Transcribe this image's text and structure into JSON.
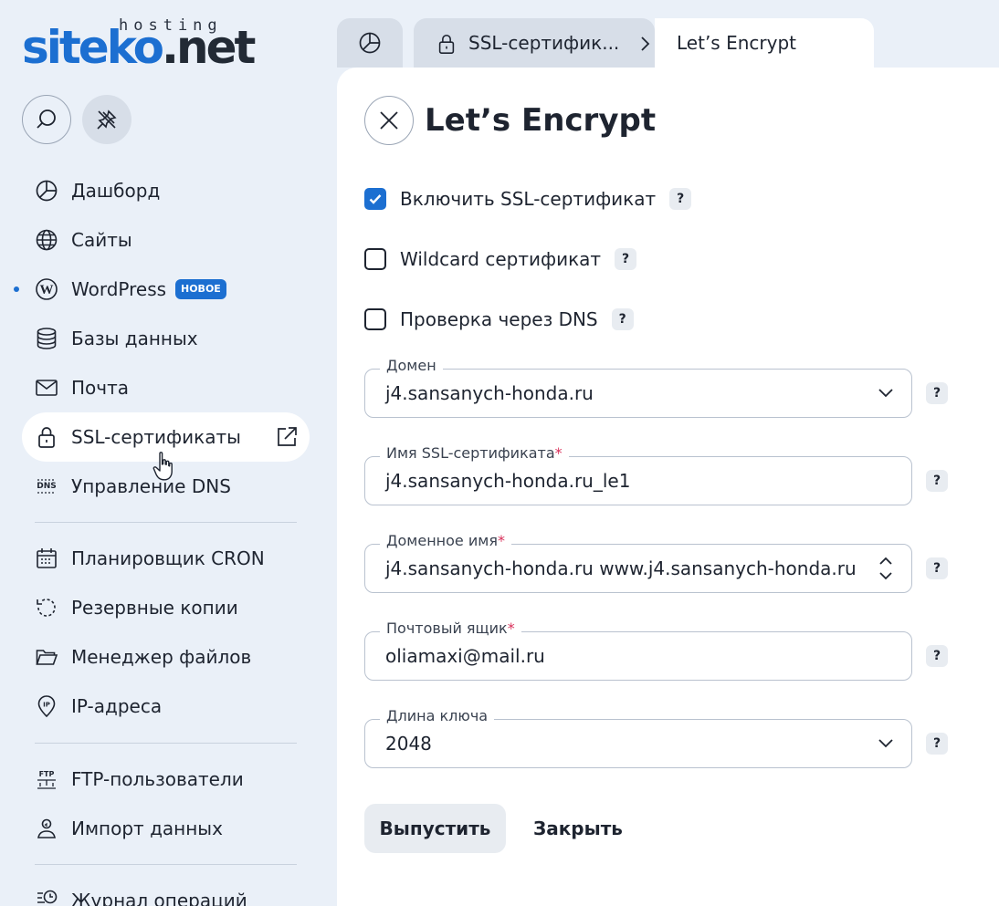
{
  "logo": {
    "brand_blue": "siteko",
    "brand_dark": ".net",
    "tagline": "hosting"
  },
  "sidebar": {
    "search_icon": "search-icon",
    "pin_icon": "unpin-icon",
    "items": [
      {
        "label": "Дашборд",
        "icon": "pie-chart-icon"
      },
      {
        "label": "Сайты",
        "icon": "globe-icon"
      },
      {
        "label": "WordPress",
        "icon": "wordpress-icon",
        "badge": "НОВОЕ"
      },
      {
        "label": "Базы данных",
        "icon": "database-icon"
      },
      {
        "label": "Почта",
        "icon": "mail-icon"
      },
      {
        "label": "SSL-сертификаты",
        "icon": "lock-icon",
        "active": true
      },
      {
        "label": "Управление DNS",
        "icon": "dns-icon"
      },
      {
        "label": "Планировщик CRON",
        "icon": "calendar-icon"
      },
      {
        "label": "Резервные копии",
        "icon": "backup-icon"
      },
      {
        "label": "Менеджер файлов",
        "icon": "folder-icon"
      },
      {
        "label": "IP-адреса",
        "icon": "ip-pin-icon"
      },
      {
        "label": "FTP-пользователи",
        "icon": "ftp-icon"
      },
      {
        "label": "Импорт данных",
        "icon": "import-icon"
      },
      {
        "label": "Журнал операций",
        "icon": "log-icon"
      }
    ]
  },
  "breadcrumb": {
    "home_icon": "pie-chart-icon",
    "parent_label": "SSL-сертифик...",
    "current_label": "Let’s Encrypt"
  },
  "form": {
    "title": "Let’s Encrypt",
    "help_mark": "?",
    "checkboxes": [
      {
        "label": "Включить SSL-сертификат",
        "checked": true
      },
      {
        "label": "Wildcard сертификат",
        "checked": false
      },
      {
        "label": "Проверка через DNS",
        "checked": false
      }
    ],
    "fields": {
      "domain": {
        "label": "Домен",
        "value": "j4.sansanych-honda.ru",
        "type": "select"
      },
      "cert_name": {
        "label": "Имя SSL-сертификата",
        "value": "j4.sansanych-honda.ru_le1",
        "required": true
      },
      "domain_names": {
        "label": "Доменное имя",
        "value": "j4.sansanych-honda.ru www.j4.sansanych-honda.ru",
        "required": true,
        "type": "multiselect"
      },
      "email": {
        "label": "Почтовый ящик",
        "value": "oliamaxi@mail.ru",
        "required": true
      },
      "key_length": {
        "label": "Длина ключа",
        "value": "2048",
        "type": "select"
      }
    },
    "submit_label": "Выпустить",
    "close_label": "Закрыть",
    "required_mark": "*"
  },
  "colors": {
    "accent": "#1c6fd1",
    "sidebar_bg": "#eaf0f8",
    "required": "#d9305a"
  }
}
